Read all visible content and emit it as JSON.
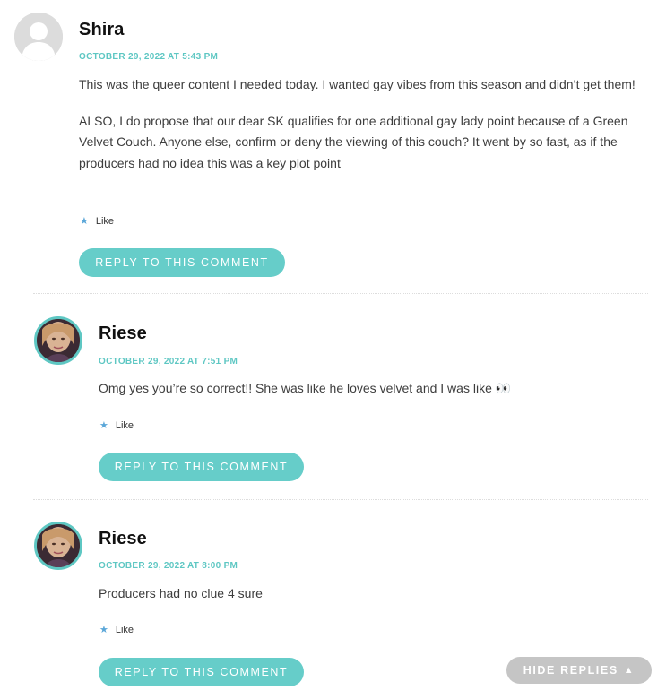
{
  "comments": [
    {
      "author": "Shira",
      "date": "OCTOBER 29, 2022 AT 5:43 PM",
      "paragraphs": [
        "This was the queer content I needed today. I wanted gay vibes from this season and didn’t get them!",
        "ALSO, I do propose that our dear SK qualifies for one additional gay lady point because of a Green Velvet Couch. Anyone else, confirm or deny the viewing of this couch? It went by so fast, as if the producers had no idea this was a key plot point"
      ],
      "like_label": "Like",
      "reply_label": "REPLY TO THIS COMMENT"
    },
    {
      "author": "Riese",
      "date": "OCTOBER 29, 2022 AT 7:51 PM",
      "paragraphs": [
        "Omg yes you’re so correct!! She was like he loves velvet and I was like 👀"
      ],
      "like_label": "Like",
      "reply_label": "REPLY TO THIS COMMENT"
    },
    {
      "author": "Riese",
      "date": "OCTOBER 29, 2022 AT 8:00 PM",
      "paragraphs": [
        "Producers had no clue 4 sure"
      ],
      "like_label": "Like",
      "reply_label": "REPLY TO THIS COMMENT"
    }
  ],
  "hide_replies_label": "HIDE REPLIES",
  "colors": {
    "accent": "#66cdc9",
    "date": "#5ec7c3",
    "like_star": "#5aa6d8",
    "hide_button": "#c5c5c5"
  },
  "icons": {
    "like": "star-icon",
    "hide_arrow": "triangle-up-icon",
    "default_avatar": "user-silhouette-icon"
  }
}
